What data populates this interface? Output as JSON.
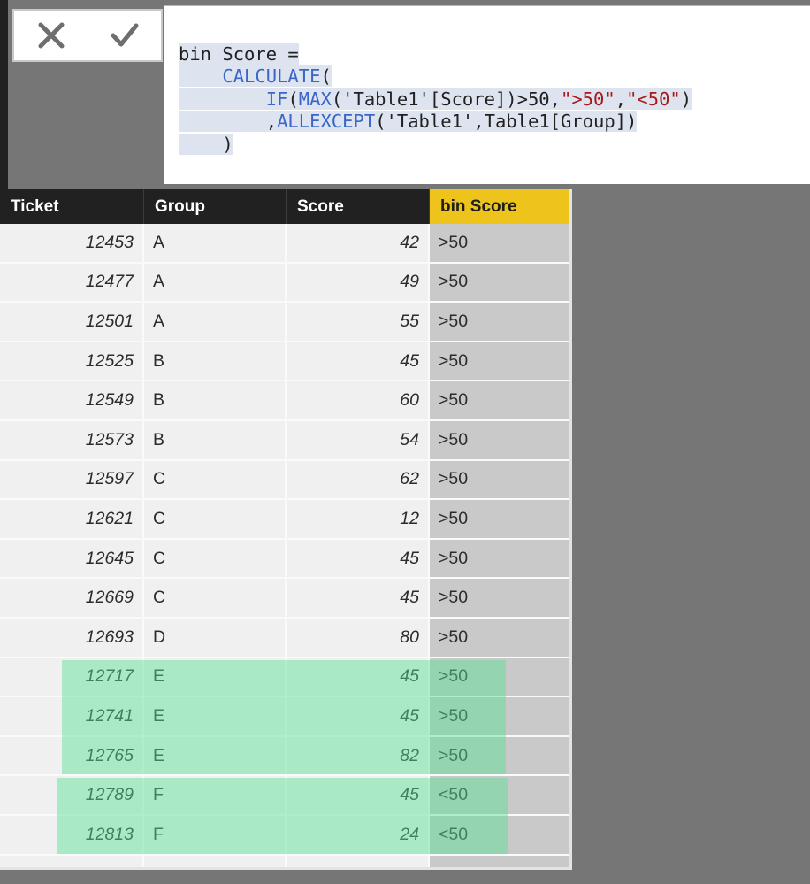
{
  "formula_bar": {
    "cancel_label": "✕",
    "cancel_name": "Cancel",
    "accept_label": "✓",
    "accept_name": "Accept",
    "measure_name": "bin Score",
    "code_lines": [
      "bin Score =",
      "    CALCULATE(",
      "        IF(MAX('Table1'[Score])>50,\">50\",\"<50\")",
      "        ,ALLEXCEPT('Table1',Table1[Group])",
      "    )"
    ],
    "code_full": "bin Score =\n    CALCULATE(\n        IF(MAX('Table1'[Score])>50,\">50\",\"<50\")\n        ,ALLEXCEPT('Table1',Table1[Group])\n    )",
    "tokens": {
      "line1": {
        "text": "bin Score ="
      },
      "line2": {
        "fn": "CALCULATE",
        "paren": "("
      },
      "line3": {
        "fn1": "IF",
        "fn2": "MAX",
        "ref": "('Table1'[Score])>50,",
        "str1": "\">50\"",
        "comma": ",",
        "str2": "\"<50\"",
        "close": ")"
      },
      "line4": {
        "comma": ",",
        "fn": "ALLEXCEPT",
        "ref": "('Table1',Table1[Group])"
      },
      "line5": {
        "text": ")"
      }
    }
  },
  "table": {
    "columns": [
      {
        "key": "ticket",
        "label": "Ticket",
        "align": "right",
        "accent": false
      },
      {
        "key": "group",
        "label": "Group",
        "align": "left",
        "accent": false
      },
      {
        "key": "score",
        "label": "Score",
        "align": "right",
        "accent": false
      },
      {
        "key": "bin",
        "label": "bin Score",
        "align": "left",
        "accent": true
      }
    ],
    "accent_color": "#eec31c",
    "header_bg": "#212121",
    "row_bg": "#f0f0f0",
    "measure_col_bg": "#c9c9c9",
    "highlight_color": "#5ae296",
    "rows": [
      {
        "ticket": "12453",
        "group": "A",
        "score": "42",
        "bin": ">50",
        "highlighted": false
      },
      {
        "ticket": "12477",
        "group": "A",
        "score": "49",
        "bin": ">50",
        "highlighted": false
      },
      {
        "ticket": "12501",
        "group": "A",
        "score": "55",
        "bin": ">50",
        "highlighted": false
      },
      {
        "ticket": "12525",
        "group": "B",
        "score": "45",
        "bin": ">50",
        "highlighted": false
      },
      {
        "ticket": "12549",
        "group": "B",
        "score": "60",
        "bin": ">50",
        "highlighted": false
      },
      {
        "ticket": "12573",
        "group": "B",
        "score": "54",
        "bin": ">50",
        "highlighted": false
      },
      {
        "ticket": "12597",
        "group": "C",
        "score": "62",
        "bin": ">50",
        "highlighted": false
      },
      {
        "ticket": "12621",
        "group": "C",
        "score": "12",
        "bin": ">50",
        "highlighted": false
      },
      {
        "ticket": "12645",
        "group": "C",
        "score": "45",
        "bin": ">50",
        "highlighted": false
      },
      {
        "ticket": "12669",
        "group": "C",
        "score": "45",
        "bin": ">50",
        "highlighted": false
      },
      {
        "ticket": "12693",
        "group": "D",
        "score": "80",
        "bin": ">50",
        "highlighted": false
      },
      {
        "ticket": "12717",
        "group": "E",
        "score": "45",
        "bin": ">50",
        "highlighted": true
      },
      {
        "ticket": "12741",
        "group": "E",
        "score": "45",
        "bin": ">50",
        "highlighted": true
      },
      {
        "ticket": "12765",
        "group": "E",
        "score": "82",
        "bin": ">50",
        "highlighted": true
      },
      {
        "ticket": "12789",
        "group": "F",
        "score": "45",
        "bin": "<50",
        "highlighted": true
      },
      {
        "ticket": "12813",
        "group": "F",
        "score": "24",
        "bin": "<50",
        "highlighted": true
      }
    ],
    "highlight_groups": [
      {
        "group": "E",
        "rows": [
          "12717",
          "12741",
          "12765"
        ]
      },
      {
        "group": "F",
        "rows": [
          "12789",
          "12813"
        ]
      }
    ]
  }
}
